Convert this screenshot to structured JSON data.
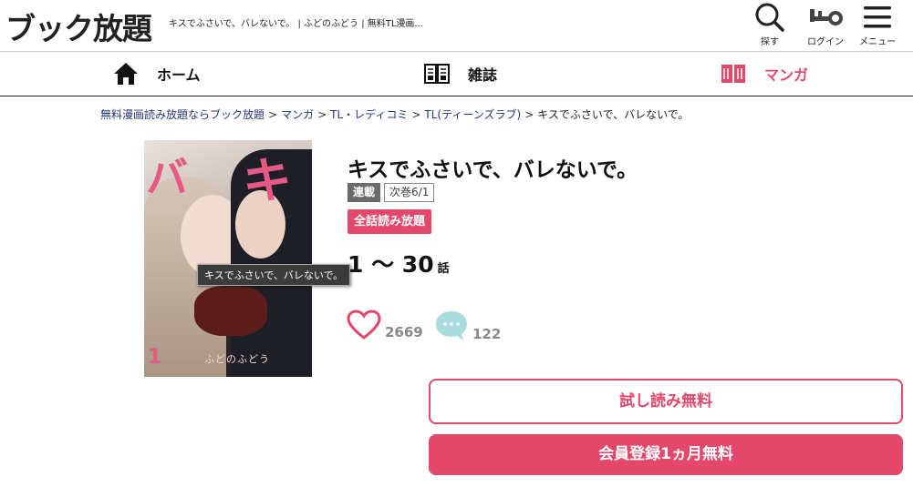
{
  "header": {
    "logo": "ブック放題",
    "tagline": "キスでふさいで、バレないで。 | ふどのふどう | 無料TL漫画...",
    "search_label": "探す",
    "login_label": "ログイン",
    "menu_label": "メニュー"
  },
  "nav": {
    "home": "ホーム",
    "magazine": "雑誌",
    "manga": "マンガ"
  },
  "breadcrumb": {
    "items": [
      "無料漫画読み放題ならブック放題",
      "マンガ",
      "TL・レディコミ",
      "TL(ティーンズラブ)"
    ],
    "current": "キスでふさいで、バレないで。",
    "separator": ">"
  },
  "cover": {
    "title_ki": "キ",
    "title_ba": "バ",
    "author": "ふどのふどう",
    "volume": "1",
    "tooltip": "キスでふさいで、バレないで。"
  },
  "book": {
    "title": "キスでふさいで、バレないで。",
    "badge_serial": "連載",
    "badge_next": "次巻6/1",
    "badge_all_read": "全話読み放題",
    "episode_range": "1 〜 30",
    "episode_unit": "話",
    "likes": "2669",
    "comments": "122"
  },
  "actions": {
    "trial": "試し読み無料",
    "register": "会員登録1ヵ月無料"
  },
  "colors": {
    "accent": "#e3486a",
    "link": "#27367a",
    "icon_like": "#e3486a",
    "icon_comment": "#a9dcdf"
  }
}
